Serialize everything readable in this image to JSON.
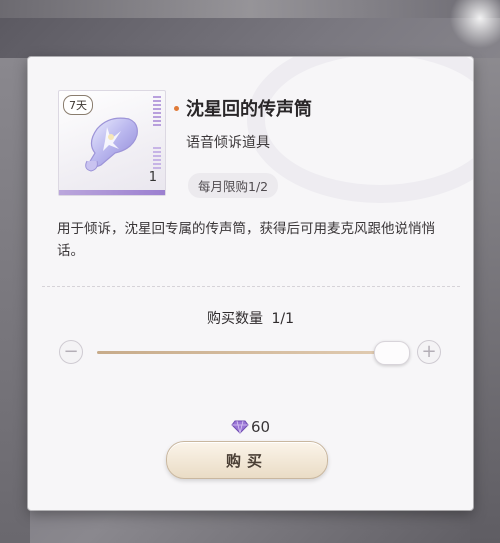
{
  "item": {
    "duration": "7天",
    "count": "1",
    "name": "沈星回的传声筒",
    "type": "语音倾诉道具",
    "purchase_limit": "每月限购1/2",
    "description": "用于倾诉，沈星回专属的传声筒，获得后可用麦克风跟他说悄悄话。"
  },
  "purchase": {
    "quantity_label": "购买数量",
    "quantity_value": "1/1",
    "minus_symbol": "−",
    "plus_symbol": "+",
    "slider_fraction": 1.0,
    "price": "60",
    "currency_icon": "diamond-icon",
    "buy_label": "购买"
  },
  "colors": {
    "rarity_dot": "#e07a38",
    "slider_fill": "#c7ab8a",
    "button_bg": "#eadcc6",
    "gem_purple": "#8b62c9"
  }
}
